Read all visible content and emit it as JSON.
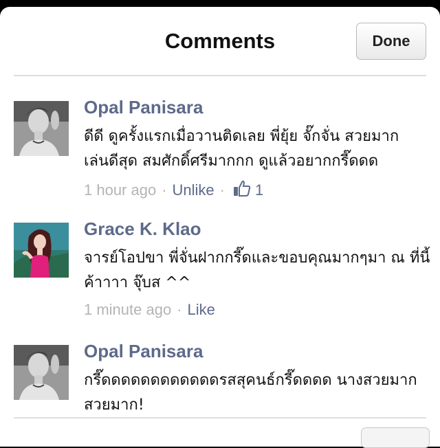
{
  "header": {
    "title": "Comments",
    "done_label": "Done"
  },
  "comments": [
    {
      "author": "Opal Panisara",
      "lines": [
        "ดีดี ดูครั้งแรกเมื่อวานติดเลย พี่ยุ้ย จั๊กจั่น สวยมาก",
        "เล่นดีสุด สมศักดิ์ศรีมากกก ดูแล้วอยากกรี๊ดดด"
      ],
      "time": "1 hour ago",
      "action": "Unlike",
      "like_count": "1"
    },
    {
      "author": "Grace K. Klao",
      "lines": [
        "จารย์โอปขา พี่จั่นฝากกรี๊ดและขอบคุณมากๆมา ณ ที่นี้",
        "ค้าาาา จุ๊บส ^^"
      ],
      "time": "1 minute ago",
      "action": "Like"
    },
    {
      "author": "Opal Panisara",
      "lines": [
        "กรี๊ดดดดดดดดดดดดรสสุคนธ์กรี๊ดดดด นางสวยมาก",
        "สวยมาก!"
      ]
    }
  ],
  "icons": {
    "like": "thumbs-up-icon"
  },
  "colors": {
    "author": "#5d6a8a",
    "meta": "#b4b4b4",
    "link": "#5d6a8a"
  }
}
